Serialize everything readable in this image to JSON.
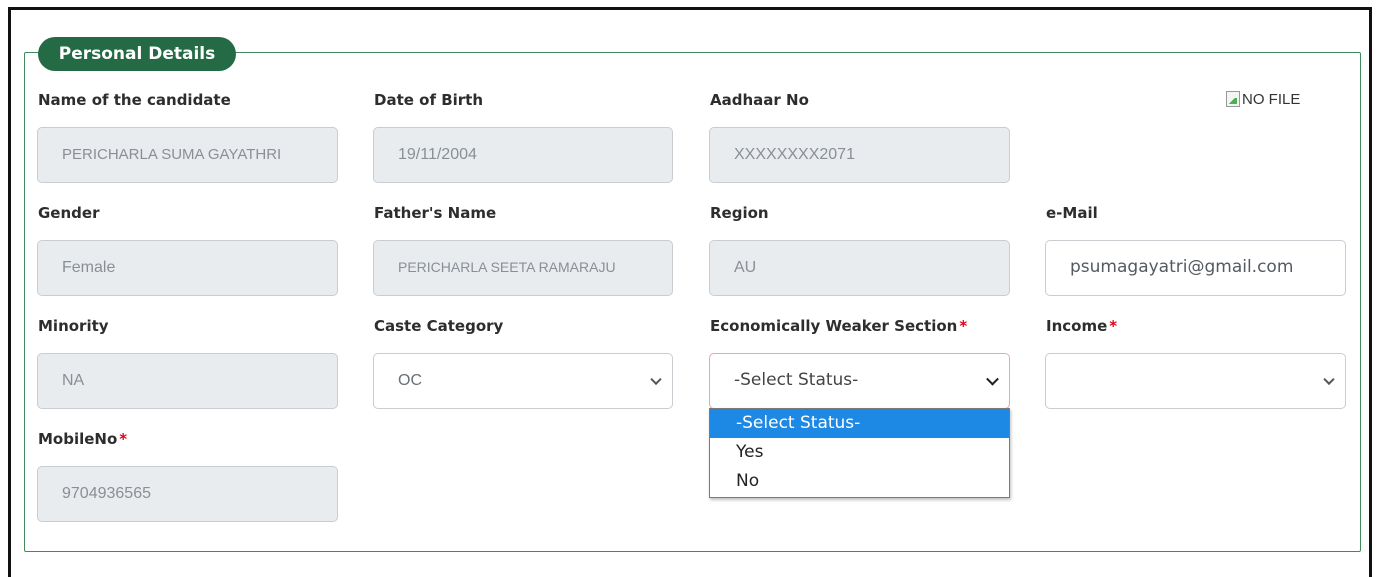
{
  "section": {
    "legend": "Personal Details"
  },
  "photo": {
    "alt_text": "NO FILE"
  },
  "fields": {
    "name": {
      "label": "Name of the candidate",
      "value": "PERICHARLA SUMA GAYATHRI"
    },
    "dob": {
      "label": "Date of Birth",
      "value": "19/11/2004"
    },
    "aadhaar": {
      "label": "Aadhaar No",
      "value": "XXXXXXXX2071"
    },
    "gender": {
      "label": "Gender",
      "value": "Female"
    },
    "father": {
      "label": "Father's Name",
      "value": "PERICHARLA SEETA RAMARAJU"
    },
    "region": {
      "label": "Region",
      "value": "AU"
    },
    "email": {
      "label": "e-Mail",
      "value": "psumagayatri@gmail.com"
    },
    "minority": {
      "label": "Minority",
      "value": "NA"
    },
    "caste": {
      "label": "Caste Category",
      "value": "OC"
    },
    "ews": {
      "label": "Economically Weaker Section",
      "required_mark": "*",
      "value": "-Select Status-"
    },
    "income": {
      "label": "Income",
      "required_mark": "*",
      "value": ""
    },
    "mobile": {
      "label": "MobileNo",
      "required_mark": "*",
      "value": "9704936565"
    }
  },
  "ews_dropdown": {
    "options": [
      "-Select Status-",
      "Yes",
      "No"
    ],
    "highlighted": "-Select Status-"
  },
  "colors": {
    "accent_green": "#246b45",
    "fieldset_border": "#3f8a5f",
    "required": "#e0001b",
    "option_highlight": "#1e88e5"
  }
}
